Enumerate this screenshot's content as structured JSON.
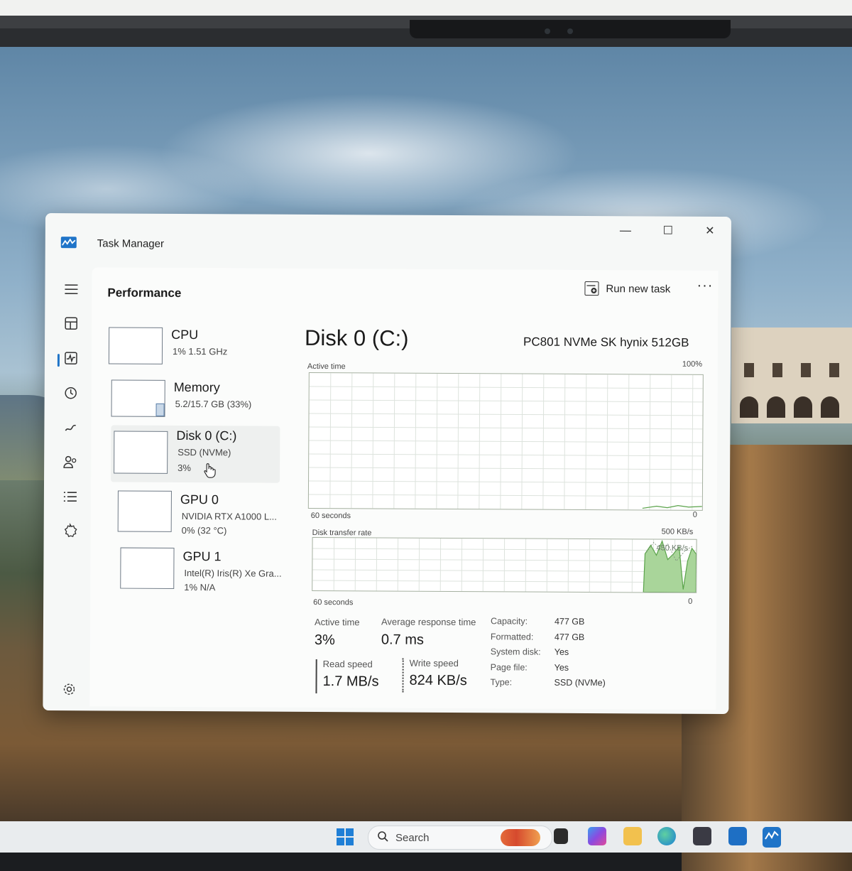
{
  "window": {
    "title": "Task Manager",
    "controls": {
      "minimize": "—",
      "maximize": "☐",
      "close": "✕"
    }
  },
  "header": {
    "page_title": "Performance",
    "run_new_task": "Run new task",
    "more": "···"
  },
  "devices": [
    {
      "name": "CPU",
      "line1": "1% 1.51 GHz",
      "line2": ""
    },
    {
      "name": "Memory",
      "line1": "5.2/15.7 GB (33%)",
      "line2": ""
    },
    {
      "name": "Disk 0 (C:)",
      "line1": "SSD (NVMe)",
      "line2": "3%"
    },
    {
      "name": "GPU 0",
      "line1": "NVIDIA RTX A1000 L...",
      "line2": "0% (32 °C)"
    },
    {
      "name": "GPU 1",
      "line1": "Intel(R) Iris(R) Xe Gra...",
      "line2": "1% N/A"
    }
  ],
  "detail": {
    "title": "Disk 0 (C:)",
    "model": "PC801 NVMe SK hynix 512GB",
    "active_graph": {
      "label": "Active time",
      "max": "100%",
      "span": "60 seconds",
      "min": "0"
    },
    "transfer_graph": {
      "label": "Disk transfer rate",
      "max": "500 KB/s",
      "inner": "450 KB/s",
      "span": "60 seconds",
      "min": "0"
    },
    "stats": {
      "active_time_label": "Active time",
      "active_time_value": "3%",
      "avg_resp_label": "Average response time",
      "avg_resp_value": "0.7 ms",
      "read_label": "Read speed",
      "read_value": "1.7 MB/s",
      "write_label": "Write speed",
      "write_value": "824 KB/s"
    },
    "properties": [
      {
        "key": "Capacity:",
        "value": "477 GB"
      },
      {
        "key": "Formatted:",
        "value": "477 GB"
      },
      {
        "key": "System disk:",
        "value": "Yes"
      },
      {
        "key": "Page file:",
        "value": "Yes"
      },
      {
        "key": "Type:",
        "value": "SSD (NVMe)"
      }
    ]
  },
  "taskbar": {
    "search_label": "Search"
  },
  "colors": {
    "accent": "#1f74c8",
    "graph_fill": "#a9d59a",
    "graph_line": "#5aa34a",
    "grid": "#dde3dd"
  },
  "icons": {
    "nav": [
      "hamburger-icon",
      "processes-icon",
      "performance-icon",
      "app-history-icon",
      "startup-apps-icon",
      "users-icon",
      "details-icon",
      "services-icon",
      "settings-icon"
    ]
  }
}
